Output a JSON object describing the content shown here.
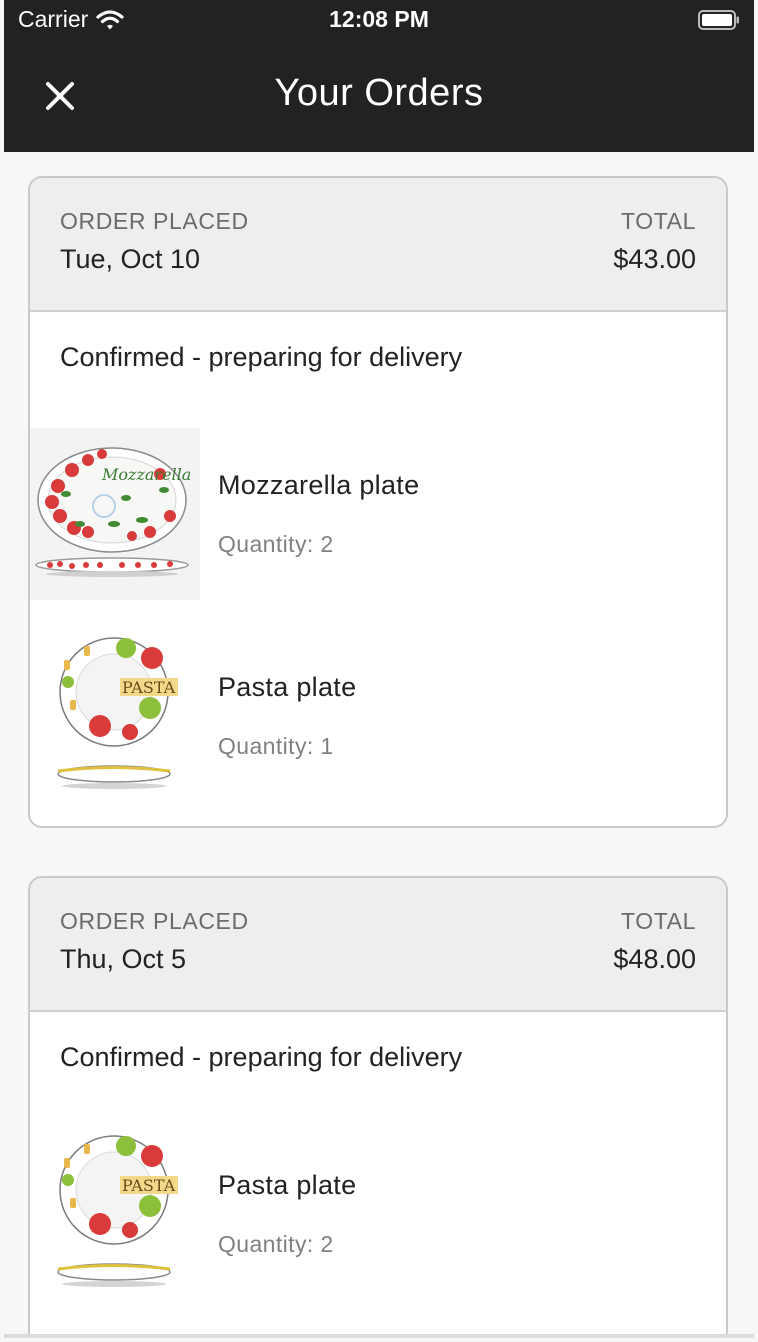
{
  "status_bar": {
    "carrier": "Carrier",
    "time": "12:08 PM"
  },
  "nav": {
    "title": "Your Orders"
  },
  "labels": {
    "order_placed": "ORDER PLACED",
    "total": "TOTAL",
    "quantity_prefix": "Quantity:"
  },
  "orders": [
    {
      "date": "Tue, Oct 10",
      "total": "$43.00",
      "status": "Confirmed - preparing for delivery",
      "items": [
        {
          "name": "Mozzarella plate",
          "quantity": "Quantity: 2",
          "image_text": "Mozzarella"
        },
        {
          "name": "Pasta plate",
          "quantity": "Quantity: 1",
          "image_text": "PASTA"
        }
      ]
    },
    {
      "date": "Thu, Oct 5",
      "total": "$48.00",
      "status": "Confirmed - preparing for delivery",
      "items": [
        {
          "name": "Pasta plate",
          "quantity": "Quantity: 2",
          "image_text": "PASTA"
        }
      ]
    }
  ],
  "colors": {
    "top_bar": "#222222",
    "header_bg": "#eeeeee",
    "card_border": "#c9c9c9"
  }
}
